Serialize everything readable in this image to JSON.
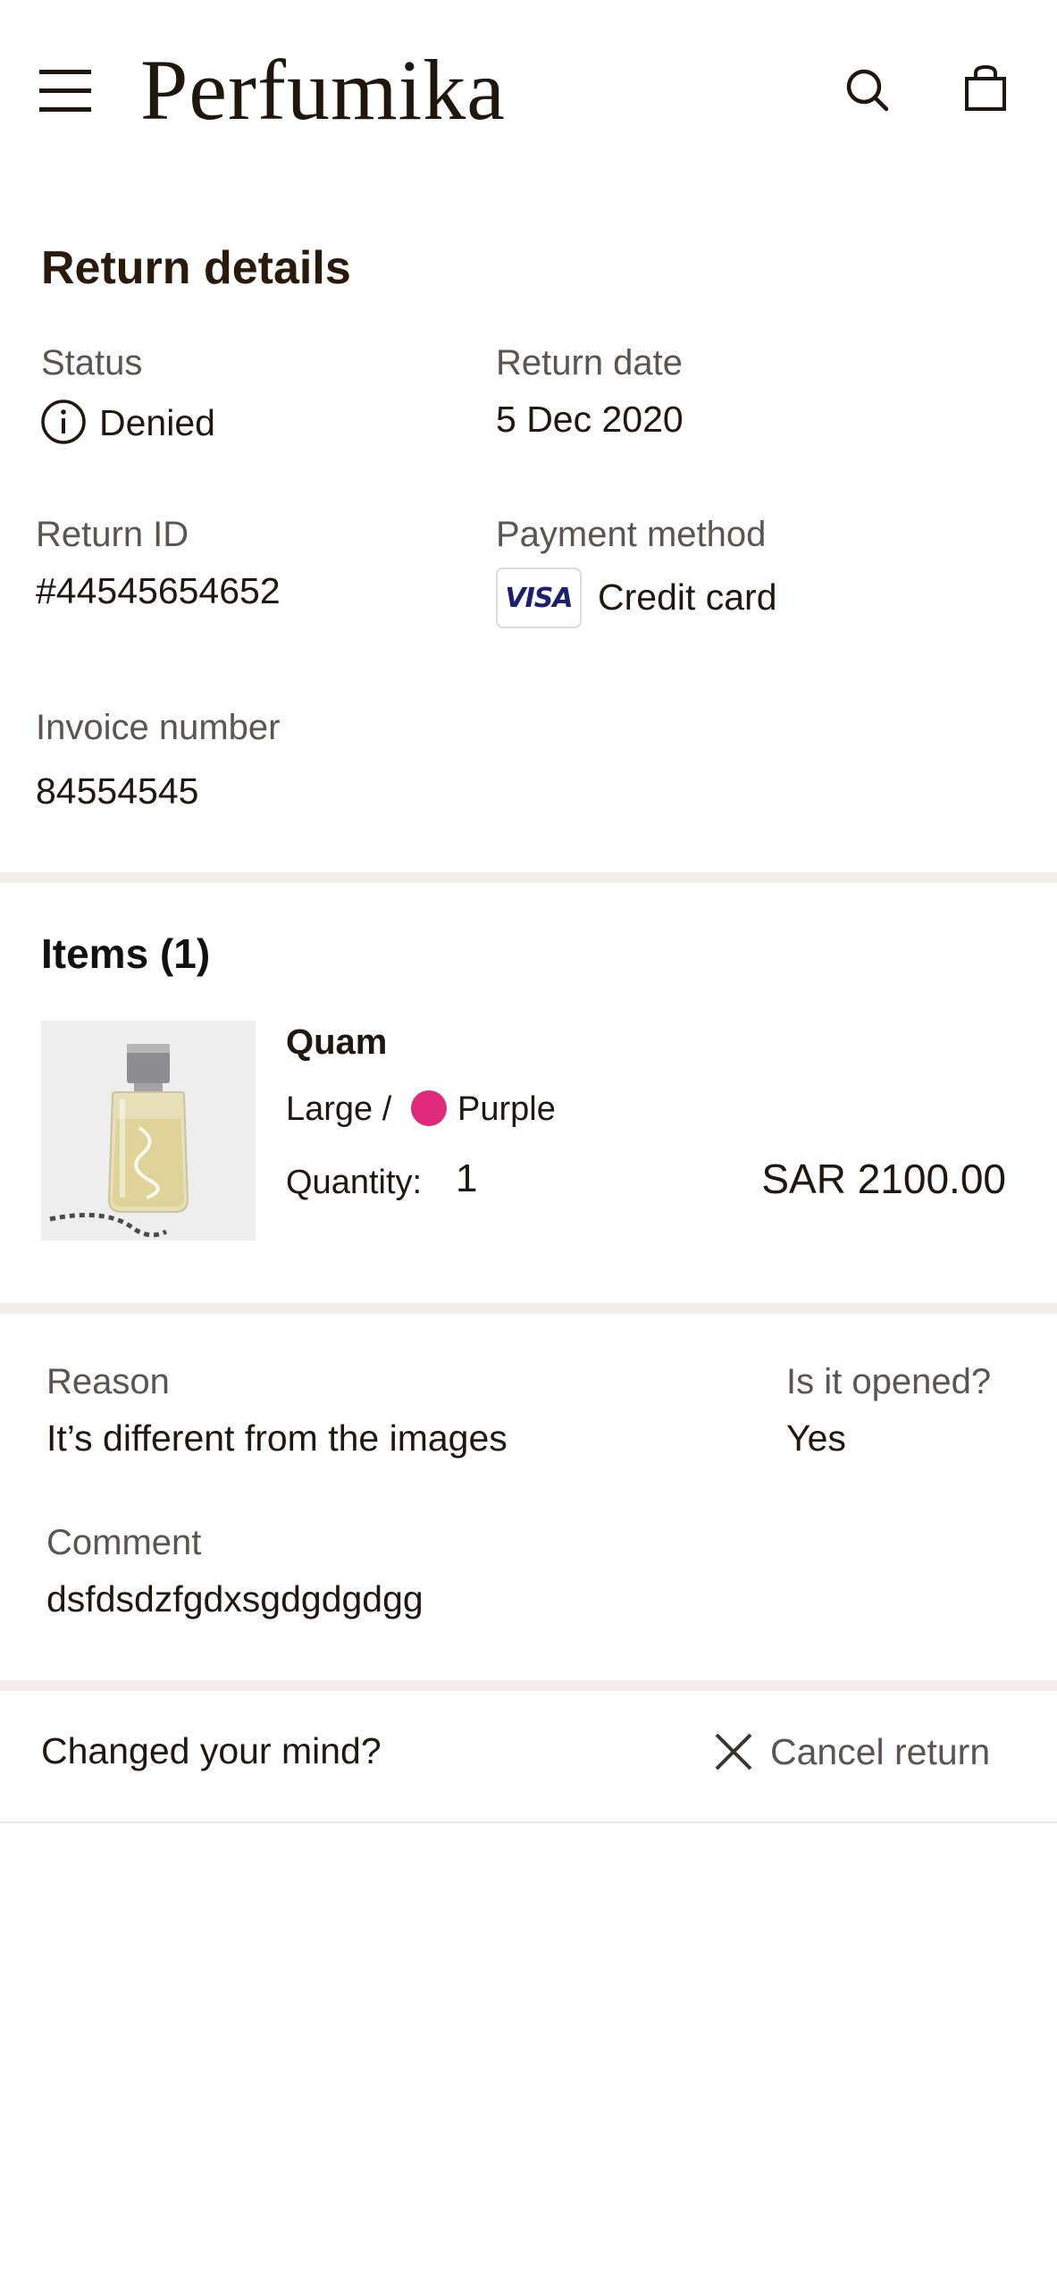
{
  "header": {
    "logo": "Perfumika",
    "menu_icon": "hamburger-menu-icon",
    "search_icon": "search-icon",
    "bag_icon": "shopping-bag-icon"
  },
  "return_details": {
    "title": "Return details",
    "status_label": "Status",
    "status_icon": "info-circle-icon",
    "status_value": "Denied",
    "return_date_label": "Return date",
    "return_date_value": "5 Dec 2020",
    "return_id_label": "Return ID",
    "return_id_value": "#44545654652",
    "payment_method_label": "Payment method",
    "payment_badge": "VISA",
    "payment_method_value": "Credit card",
    "invoice_label": "Invoice number",
    "invoice_value": "84554545"
  },
  "items": {
    "title": "Items (1)",
    "list": [
      {
        "name": "Quam",
        "size": "Large /",
        "color_name": "Purple",
        "color_hex": "#e0297a",
        "quantity_label": "Quantity:",
        "quantity_value": "1",
        "price": "SAR 2100.00"
      }
    ]
  },
  "reason": {
    "reason_label": "Reason",
    "reason_value": "It’s different from the images",
    "opened_label": "Is it opened?",
    "opened_value": "Yes",
    "comment_label": "Comment",
    "comment_value": "dsfdsdzfgdxsgdgdgdgg"
  },
  "footer": {
    "prompt": "Changed your mind?",
    "cancel_icon": "close-icon",
    "cancel_label": "Cancel return"
  },
  "colors": {
    "text_dark": "#2a1f14",
    "label_grey": "#5b5552",
    "divider": "#f1ede8",
    "visa_blue": "#1a1f71"
  }
}
